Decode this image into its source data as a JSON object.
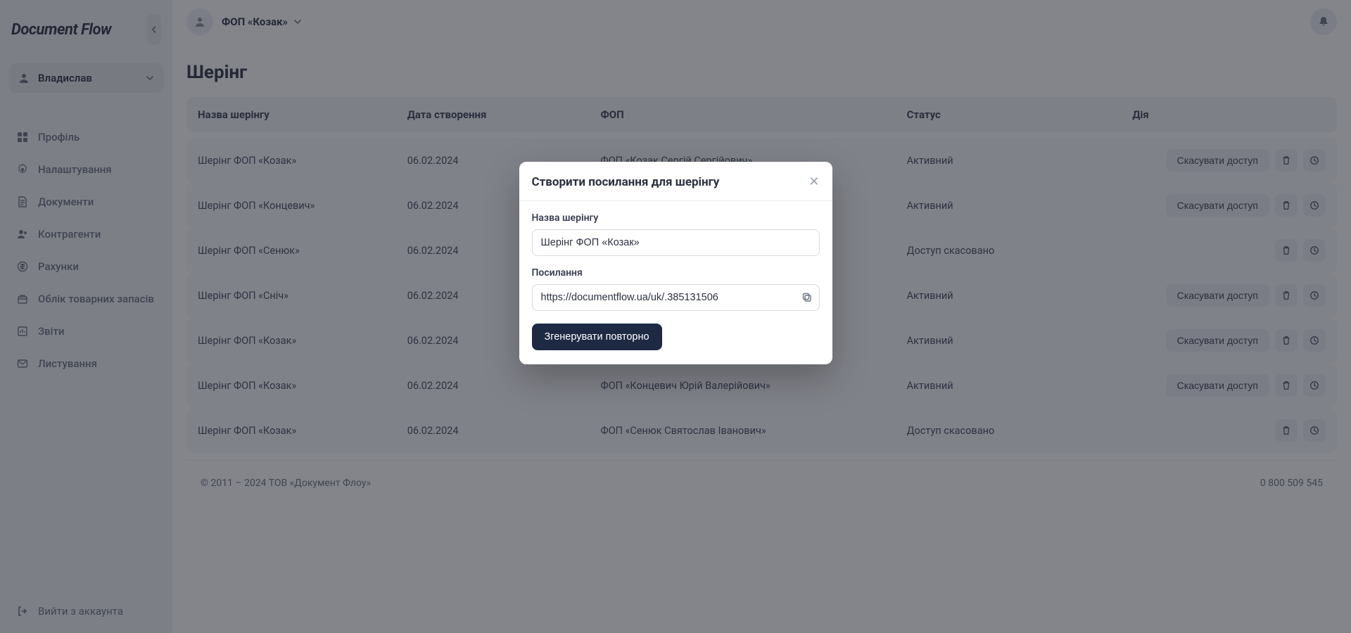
{
  "brand": "Document Flow",
  "sidebar": {
    "user_name": "Владислав",
    "items": [
      {
        "icon": "grid-icon",
        "label": "Профіль"
      },
      {
        "icon": "gear-icon",
        "label": "Налаштування"
      },
      {
        "icon": "document-icon",
        "label": "Документи"
      },
      {
        "icon": "contacts-icon",
        "label": "Контрагенти"
      },
      {
        "icon": "money-icon",
        "label": "Рахунки"
      },
      {
        "icon": "inventory-icon",
        "label": "Облік товарних запасів"
      },
      {
        "icon": "report-icon",
        "label": "Звіти"
      },
      {
        "icon": "mail-icon",
        "label": "Листування"
      }
    ],
    "logout_label": "Вийти з аккаунта"
  },
  "topbar": {
    "org_name": "ФОП «Козак»"
  },
  "page": {
    "title": "Шерінг"
  },
  "table": {
    "headers": {
      "name": "Назва шерінгу",
      "date": "Дата створення",
      "fop": "ФОП",
      "status": "Статус",
      "action": "Дія"
    },
    "revoke_label": "Скасувати доступ",
    "rows": [
      {
        "name": "Шерінг ФОП «Козак»",
        "date": "06.02.2024",
        "fop": "ФОП «Козак Сергій Сергійович»",
        "status": "Активний",
        "revokable": true
      },
      {
        "name": "Шерінг ФОП «Концевич»",
        "date": "06.02.2024",
        "fop": "",
        "status": "Активний",
        "revokable": true
      },
      {
        "name": "Шерінг ФОП «Сенюк»",
        "date": "06.02.2024",
        "fop": "",
        "status": "Доступ скасовано",
        "revokable": false
      },
      {
        "name": "Шерінг ФОП «Сніч»",
        "date": "06.02.2024",
        "fop": "",
        "status": "Активний",
        "revokable": true
      },
      {
        "name": "Шерінг ФОП «Козак»",
        "date": "06.02.2024",
        "fop": "",
        "status": "Активний",
        "revokable": true
      },
      {
        "name": "Шерінг ФОП «Козак»",
        "date": "06.02.2024",
        "fop": "ФОП «Концевич Юрій Валерійович»",
        "status": "Активний",
        "revokable": true
      },
      {
        "name": "Шерінг ФОП «Козак»",
        "date": "06.02.2024",
        "fop": "ФОП «Сенюк Святослав Іванович»",
        "status": "Доступ скасовано",
        "revokable": false
      }
    ]
  },
  "footer": {
    "copyright": "© 2011 – 2024 ТОВ «Документ Флоу»",
    "phone": "0 800 509 545"
  },
  "modal": {
    "title": "Створити посилання для шерінгу",
    "name_label": "Назва шерінгу",
    "name_value": "Шерінг ФОП «Козак»",
    "link_label": "Посилання",
    "link_value": "https://documentflow.ua/uk/.385131506",
    "regenerate_label": "Згенерувати повторно"
  }
}
